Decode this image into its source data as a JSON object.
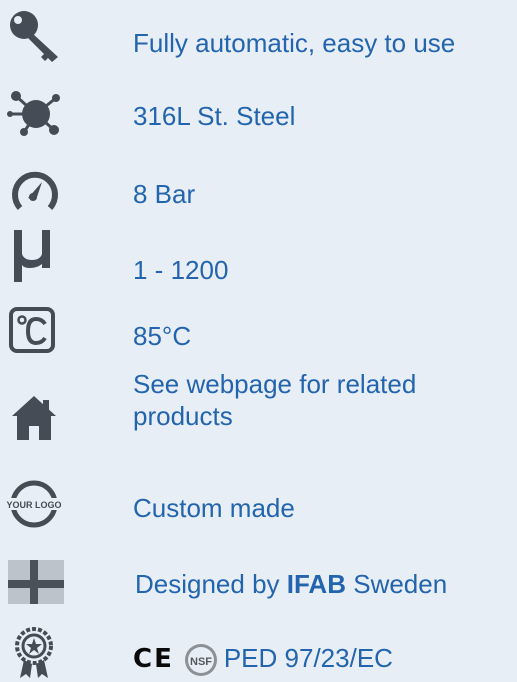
{
  "features": [
    {
      "icon": "key-icon",
      "label": "Fully automatic, easy to use"
    },
    {
      "icon": "molecule-icon",
      "label": "316L St. Steel"
    },
    {
      "icon": "pressure-gauge-icon",
      "label": "8 Bar"
    },
    {
      "icon": "micro-icon",
      "label": "1 - 1200"
    },
    {
      "icon": "temperature-celsius-icon",
      "label": "85°C"
    },
    {
      "icon": "home-icon",
      "label": "See webpage for related products"
    },
    {
      "icon": "your-logo-icon",
      "label": "Custom made",
      "logo_text": "YOUR LOGO"
    },
    {
      "icon": "sweden-flag-icon",
      "label_prefix": "Designed by ",
      "label_brand": "IFAB",
      "label_suffix": " Sweden"
    },
    {
      "icon": "certificate-icon",
      "ce_mark": "CE",
      "nsf_mark": "NSF",
      "label": "PED 97/23/EC"
    }
  ],
  "colors": {
    "text": "#2264ad",
    "icon": "#454c55",
    "background": "#e8eef5"
  }
}
